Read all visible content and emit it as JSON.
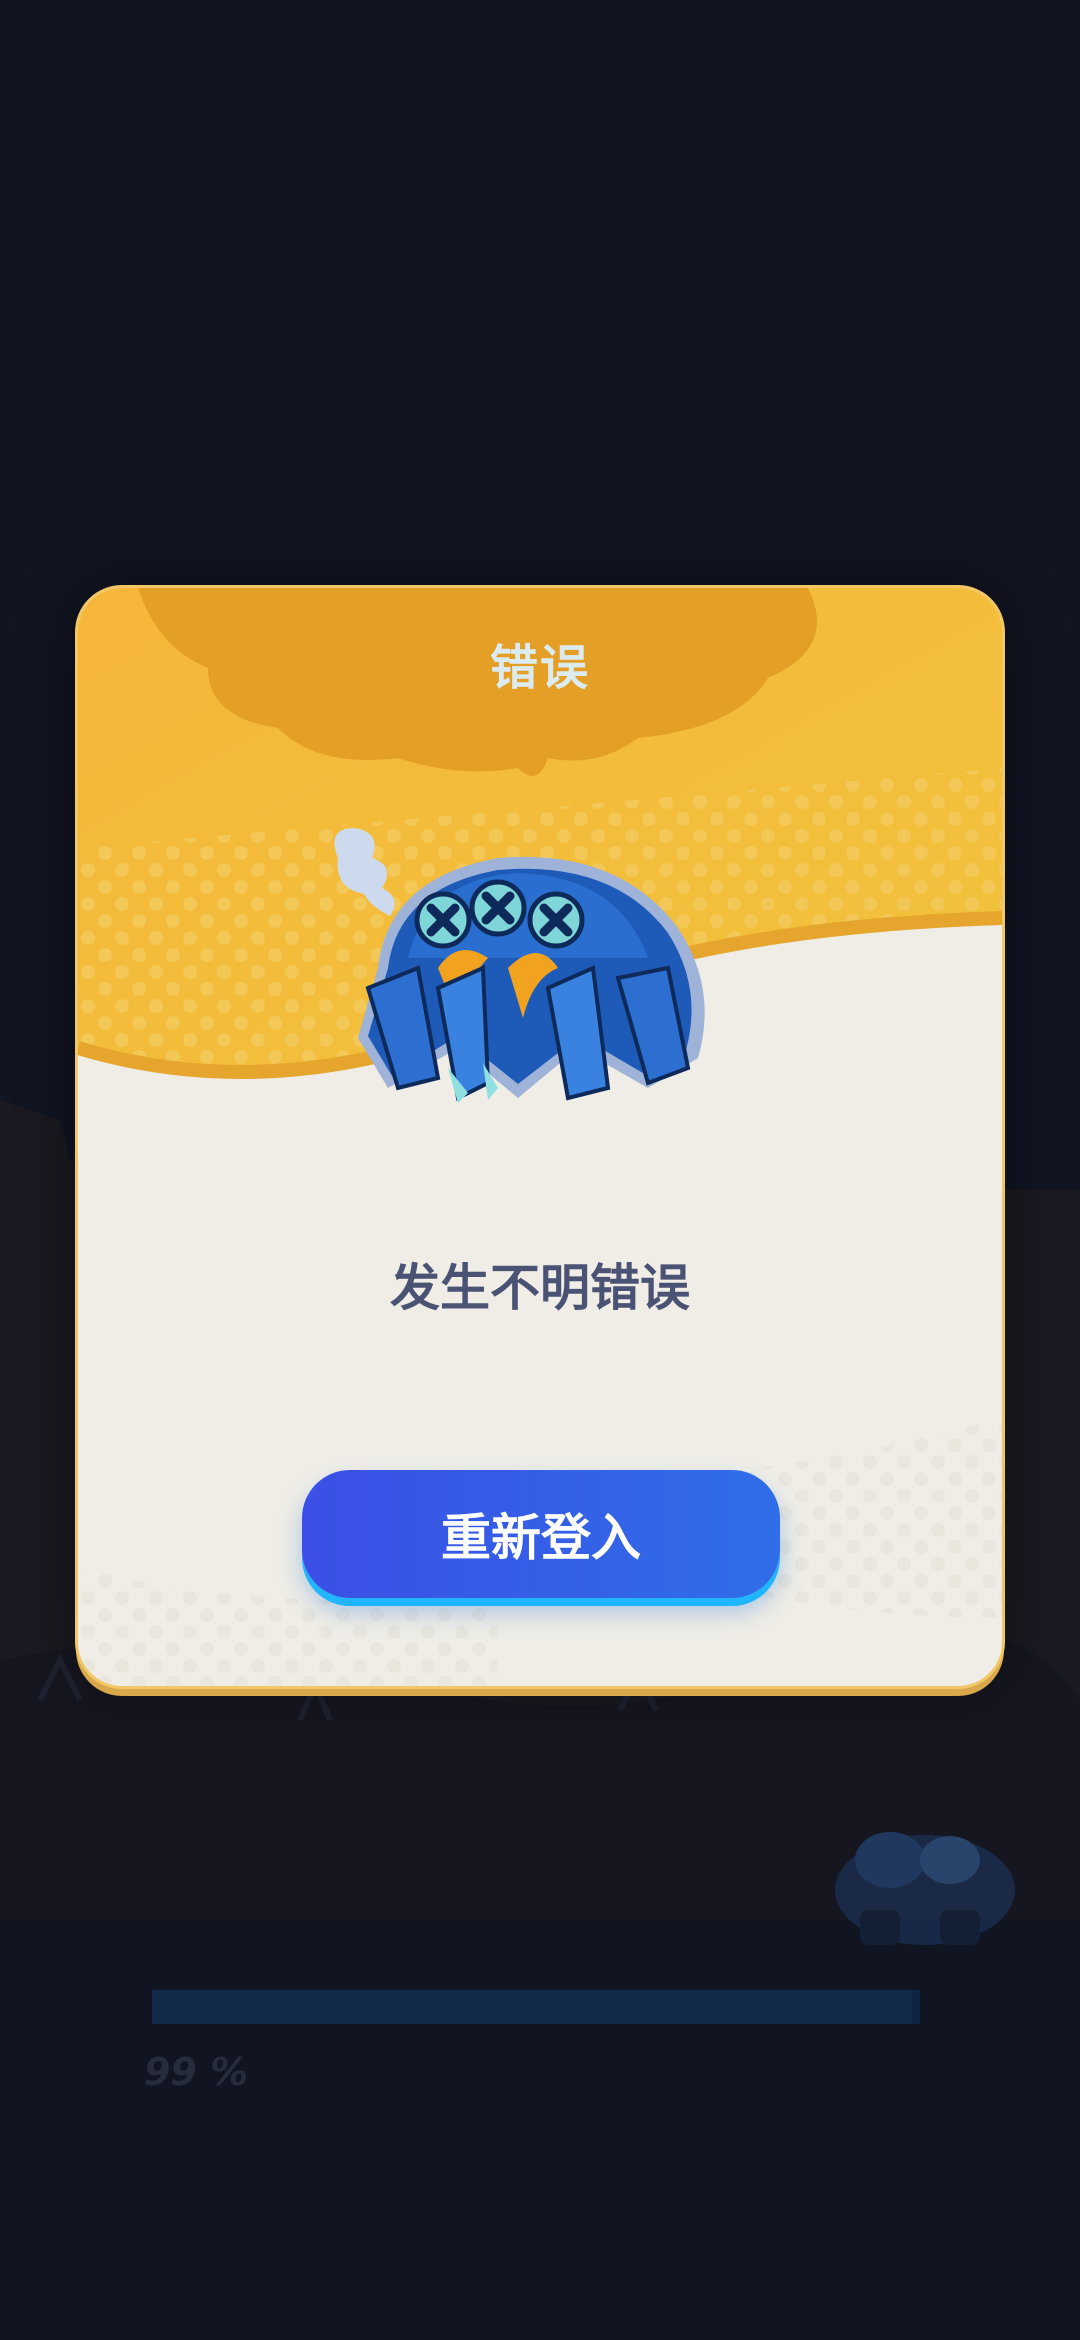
{
  "dialog": {
    "title": "错误",
    "message": "发生不明错误",
    "button_label": "重新登入"
  },
  "loading": {
    "percent_label": "99 %",
    "progress": 0.99
  },
  "colors": {
    "background": "#111522",
    "dialog_header": "#f1b72f",
    "dialog_body": "#efede6",
    "button": "#3b4fe6",
    "message_text": "#4a5373"
  },
  "icons": {
    "mascot": "broken-robot-spider-icon",
    "smoke": "smoke-puff-icon"
  }
}
